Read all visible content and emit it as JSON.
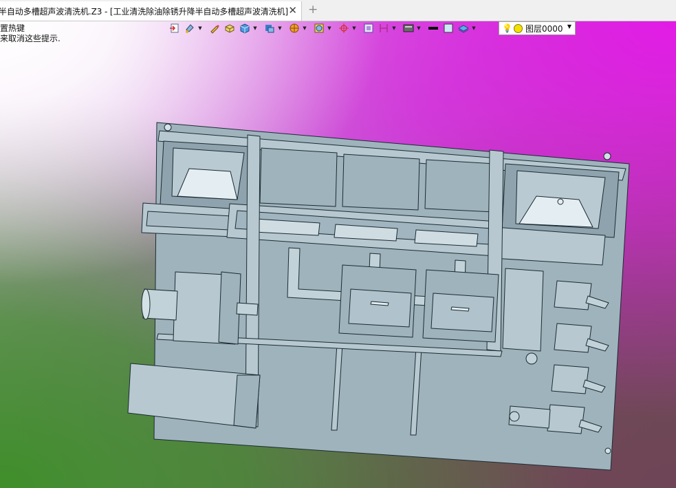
{
  "tab": {
    "title": "半自动多槽超声波清洗机.Z3 - [工业清洗除油除锈升降半自动多槽超声波清洗机]",
    "close_glyph": "✕",
    "add_glyph": "+"
  },
  "hint": {
    "line1": "置热键",
    "line2": "来取消这些提示."
  },
  "toolbar": {
    "icons": [
      "import-icon",
      "paint-icon",
      "pen-icon",
      "box-icon",
      "cube-icon",
      "shaded-view-icon",
      "render-icon",
      "frame-icon",
      "axis-icon",
      "window-icon",
      "split-icon",
      "display-icon",
      "line-color-icon",
      "fill-color-icon",
      "layer-stack-icon"
    ]
  },
  "layer": {
    "name": "图层0000",
    "bulb_color": "#f2e000"
  },
  "colors": {
    "model_fill": "#a9bcc6",
    "model_line": "#1a2a30"
  }
}
